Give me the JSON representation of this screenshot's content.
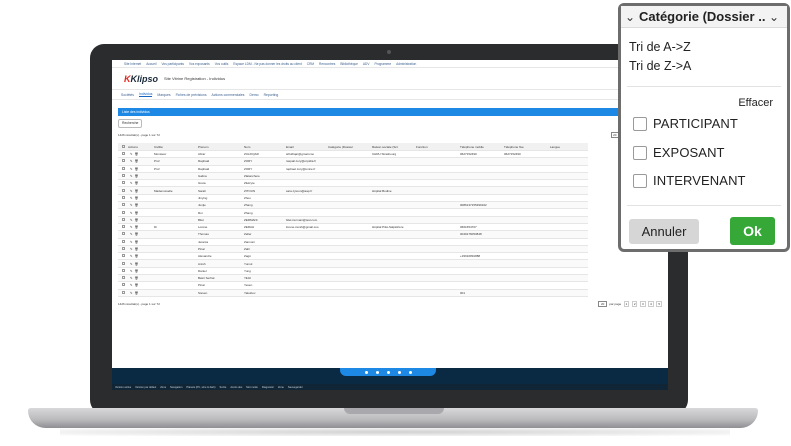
{
  "app": {
    "top_nav": [
      "Site Internet",
      "Accueil",
      "Vos participants",
      "Vos exposants",
      "Vos outils",
      "Espace LDM - Ne pas donner les droits au client",
      "CRM",
      "Rencontres",
      "Bibliothèque",
      "ADV",
      "Programme",
      "Administration"
    ],
    "logo_text": "Klipso",
    "title": "Site Vitrine Registration - Individus",
    "tabs": [
      "Sociétés",
      "Individus",
      "Marques",
      "Fiches de prévisions",
      "Actions commerciales",
      "Demo",
      "Reporting"
    ],
    "active_tab": "Individus",
    "list_title": "Liste des individus",
    "search_button": "Recherche",
    "search_placeholder": "Recherche rapide",
    "result_count_top": "1426 résultat(s) - page 1 sur 72",
    "result_count_bottom": "1426 résultat(s) - page 1 sur 72",
    "per_page_value": "20",
    "per_page_label": "par page",
    "pages": [
      "1",
      "2",
      "3",
      "4",
      "5"
    ],
    "columns": [
      "Actions",
      "Civilité",
      "Prénom",
      "Nom",
      "Email",
      "Catégorie (Dossier",
      "Raison sociale (Sct",
      "Fonction",
      "Téléphone mobile",
      "Téléphone fixe",
      "Langue"
    ],
    "rows": [
      [
        "Monsieur",
        "Abrar",
        "ZULFIQAR",
        "afzulfiqar@gmail.coo",
        "",
        "CHRU Strasbourg",
        "",
        "0627152490",
        "0627152490"
      ],
      [
        "Prof",
        "Raphaël",
        "ZORY",
        "raspail.zory@orpidia.fr",
        "",
        "",
        "",
        "",
        ""
      ],
      [
        "Prof",
        "Raphaël",
        "ZORY",
        "raphael.zory@unice.fr",
        "",
        "",
        "",
        "",
        ""
      ],
      [
        "",
        "Galina",
        "Zlatanchere",
        "",
        "",
        "",
        "",
        "",
        ""
      ],
      [
        "",
        "Greta",
        "Zlukryte",
        "",
        "",
        "",
        "",
        "",
        ""
      ],
      [
        "Mademoiselle",
        "Sarah",
        "ZITOUN",
        "sara.zytoun@aap.fr",
        "",
        "Hôpital Bodine",
        "",
        "",
        ""
      ],
      [
        "",
        "Jinying",
        "Zhou",
        "",
        "",
        "",
        "",
        "",
        ""
      ],
      [
        "",
        "Junjie",
        "Zhang",
        "",
        "",
        "",
        "",
        "0086137155399162",
        ""
      ],
      [
        "",
        "Rui",
        "Zhang",
        "",
        "",
        "",
        "",
        "",
        ""
      ],
      [
        "",
        "Bilel",
        "ZERMANI",
        "bilel.zermani@test.com",
        "",
        "",
        "",
        "",
        ""
      ],
      [
        "Dr",
        "Lorène",
        "ZERAH",
        "lorene.zerah@gmail.coo",
        "",
        "Hôpital Pitié-Salpêtrière",
        "",
        "0661654707",
        ""
      ],
      [
        "",
        "Thomas",
        "Zeller",
        "",
        "",
        "",
        "",
        "0049176053848",
        ""
      ],
      [
        "",
        "Jessica",
        "Zannoni",
        "",
        "",
        "",
        "",
        "",
        ""
      ],
      [
        "",
        "Pinar",
        "Zahr",
        "",
        "",
        "",
        "",
        "",
        ""
      ],
      [
        "",
        "Alexandre",
        "Zagö",
        "",
        "",
        "",
        "",
        "+33616891888",
        ""
      ],
      [
        "",
        "Anish",
        "Yumul",
        "",
        "",
        "",
        "",
        "",
        ""
      ],
      [
        "",
        "Daniel",
        "Yung",
        "",
        "",
        "",
        "",
        "",
        ""
      ],
      [
        "",
        "Bekir Serhat",
        "Yildiz",
        "",
        "",
        "",
        "",
        "",
        ""
      ],
      [
        "",
        "Pinar",
        "Yesen",
        "",
        "",
        "",
        "",
        "",
        ""
      ],
      [
        "",
        "Steven",
        "Yakubov",
        "",
        "",
        "",
        "",
        "001",
        ""
      ]
    ],
    "status_bar": [
      "Version active",
      "Version par défaut",
      "Zone",
      "Navigation",
      "Planets (PC, wire & dark)",
      "Sortie",
      "Accès des",
      "Mot mode",
      "Diagnostic",
      "Zone",
      "Sauvegarder"
    ]
  },
  "filter_popup": {
    "title": "Catégorie (Dossier ...",
    "sort_asc": "Tri de A->Z",
    "sort_desc": "Tri de Z->A",
    "clear": "Effacer",
    "options": [
      {
        "label": "PARTICIPANT",
        "checked": false
      },
      {
        "label": "EXPOSANT",
        "checked": false
      },
      {
        "label": "INTERVENANT",
        "checked": false
      }
    ],
    "cancel": "Annuler",
    "ok": "Ok"
  },
  "colors": {
    "accent_blue": "#1e88e5",
    "ok_green": "#36a838",
    "taskbar": "#0a2a43"
  }
}
